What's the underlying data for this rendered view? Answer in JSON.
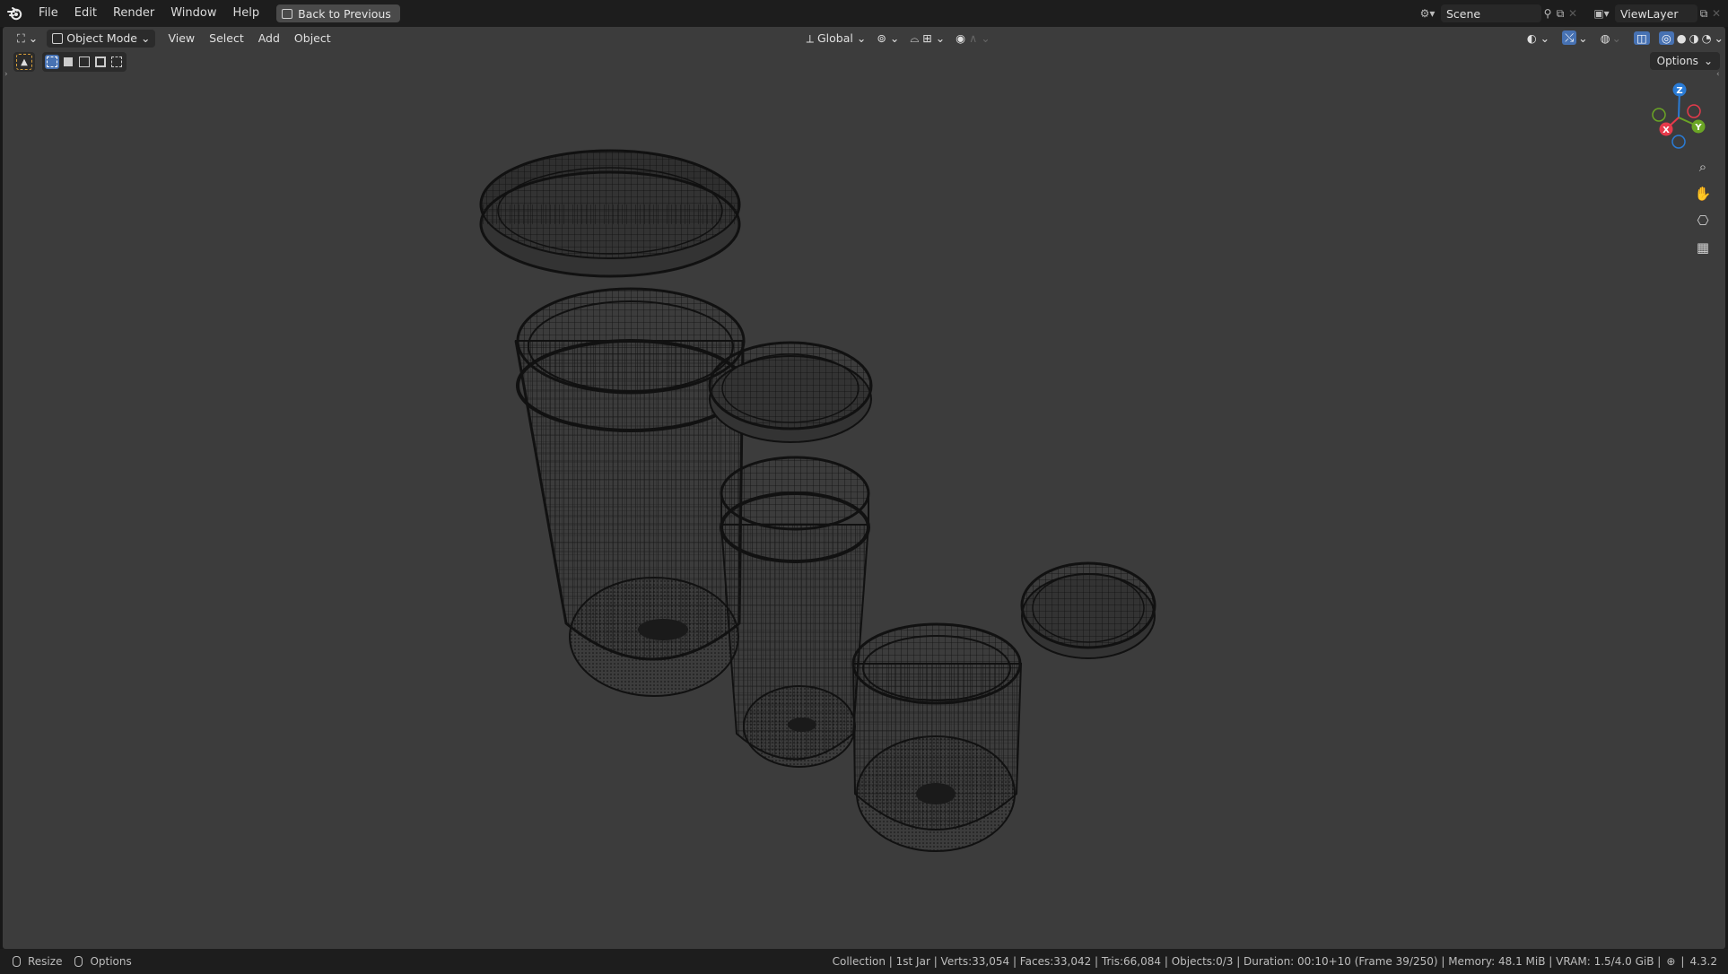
{
  "topbar": {
    "menu": [
      "File",
      "Edit",
      "Render",
      "Window",
      "Help"
    ],
    "back_button": "Back to Previous",
    "scene_name": "Scene",
    "view_layer": "ViewLayer"
  },
  "header": {
    "mode": "Object Mode",
    "menus": [
      "View",
      "Select",
      "Add",
      "Object"
    ],
    "transform_orientation": "Global",
    "options_label": "Options"
  },
  "gizmo": {
    "axis_x": "X",
    "axis_y": "Y",
    "axis_z": "Z",
    "colors": {
      "x": "#e63a4b",
      "y": "#6ba525",
      "z": "#2a7bd5"
    }
  },
  "icons": [
    "blender-logo-icon",
    "editor-type-icon",
    "object-mode-icon",
    "select-tool-icon",
    "transform-orientation-icon",
    "pivot-icon",
    "snap-icon",
    "proportional-edit-icon",
    "visibility-icon",
    "gizmo-icon",
    "overlay-icon",
    "xray-icon",
    "wireframe-shading-icon",
    "solid-shading-icon",
    "material-shading-icon",
    "rendered-shading-icon",
    "zoom-icon",
    "pan-hand-icon",
    "camera-icon",
    "grid-icon"
  ],
  "status": {
    "left_action": "Resize",
    "left_options": "Options",
    "info": "Collection | 1st Jar | Verts:33,054 | Faces:33,042 | Tris:66,084 | Objects:0/3 | Duration: 00:10+10 (Frame 39/250) | Memory: 48.1 MiB | VRAM: 1.5/4.0 GiB |",
    "version": "4.3.2"
  },
  "colors": {
    "background": "#181818",
    "viewport": "#3c3c3c",
    "accent": "#4772b3",
    "wire": "#111111"
  }
}
